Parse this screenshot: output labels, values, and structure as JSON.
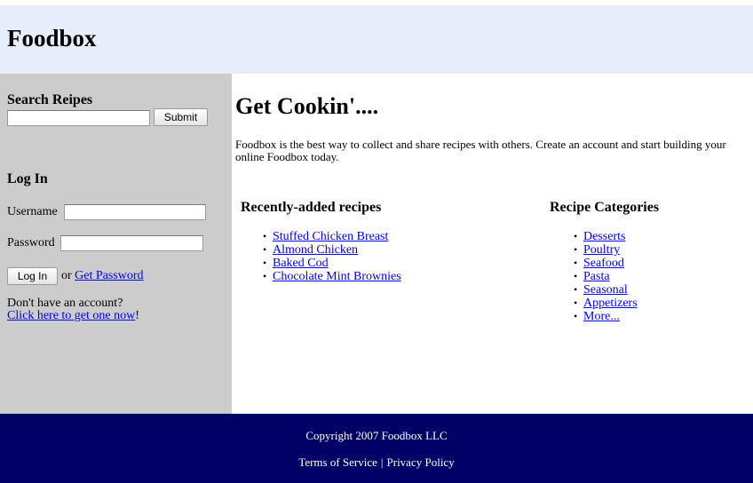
{
  "header": {
    "title": "Foodbox"
  },
  "sidebar": {
    "search": {
      "title": "Search Reipes",
      "input_value": "",
      "submit_label": "Submit"
    },
    "login": {
      "title": "Log In",
      "username_label": "Username",
      "username_value": "",
      "password_label": "Password",
      "password_value": "",
      "login_button": "Log In",
      "or_text": "or",
      "get_password_link": "Get Password",
      "no_account_text": "Don't have an account?",
      "signup_link": "Click here to get one now",
      "signup_suffix": "!"
    }
  },
  "main": {
    "heading": "Get Cookin'....",
    "intro": "Foodbox is the best way to collect and share recipes with others. Create an account and start building your online Foodbox today.",
    "recent": {
      "title": "Recently-added recipes",
      "items": [
        "Stuffed Chicken Breast",
        "Almond Chicken",
        "Baked Cod",
        "Chocolate Mint Brownies"
      ]
    },
    "categories": {
      "title": "Recipe Categories",
      "items": [
        "Desserts",
        "Poultry",
        "Seafood",
        "Pasta",
        "Seasonal",
        "Appetizers",
        "More..."
      ]
    }
  },
  "footer": {
    "copyright": "Copyright 2007 Foodbox LLC",
    "terms": "Terms of Service",
    "separator": "|",
    "privacy": "Privacy Policy"
  },
  "colors": {
    "header_bg": "#e6eefc",
    "sidebar_bg": "#cccccc",
    "footer_bg": "#000066",
    "link": "#0000ee"
  }
}
